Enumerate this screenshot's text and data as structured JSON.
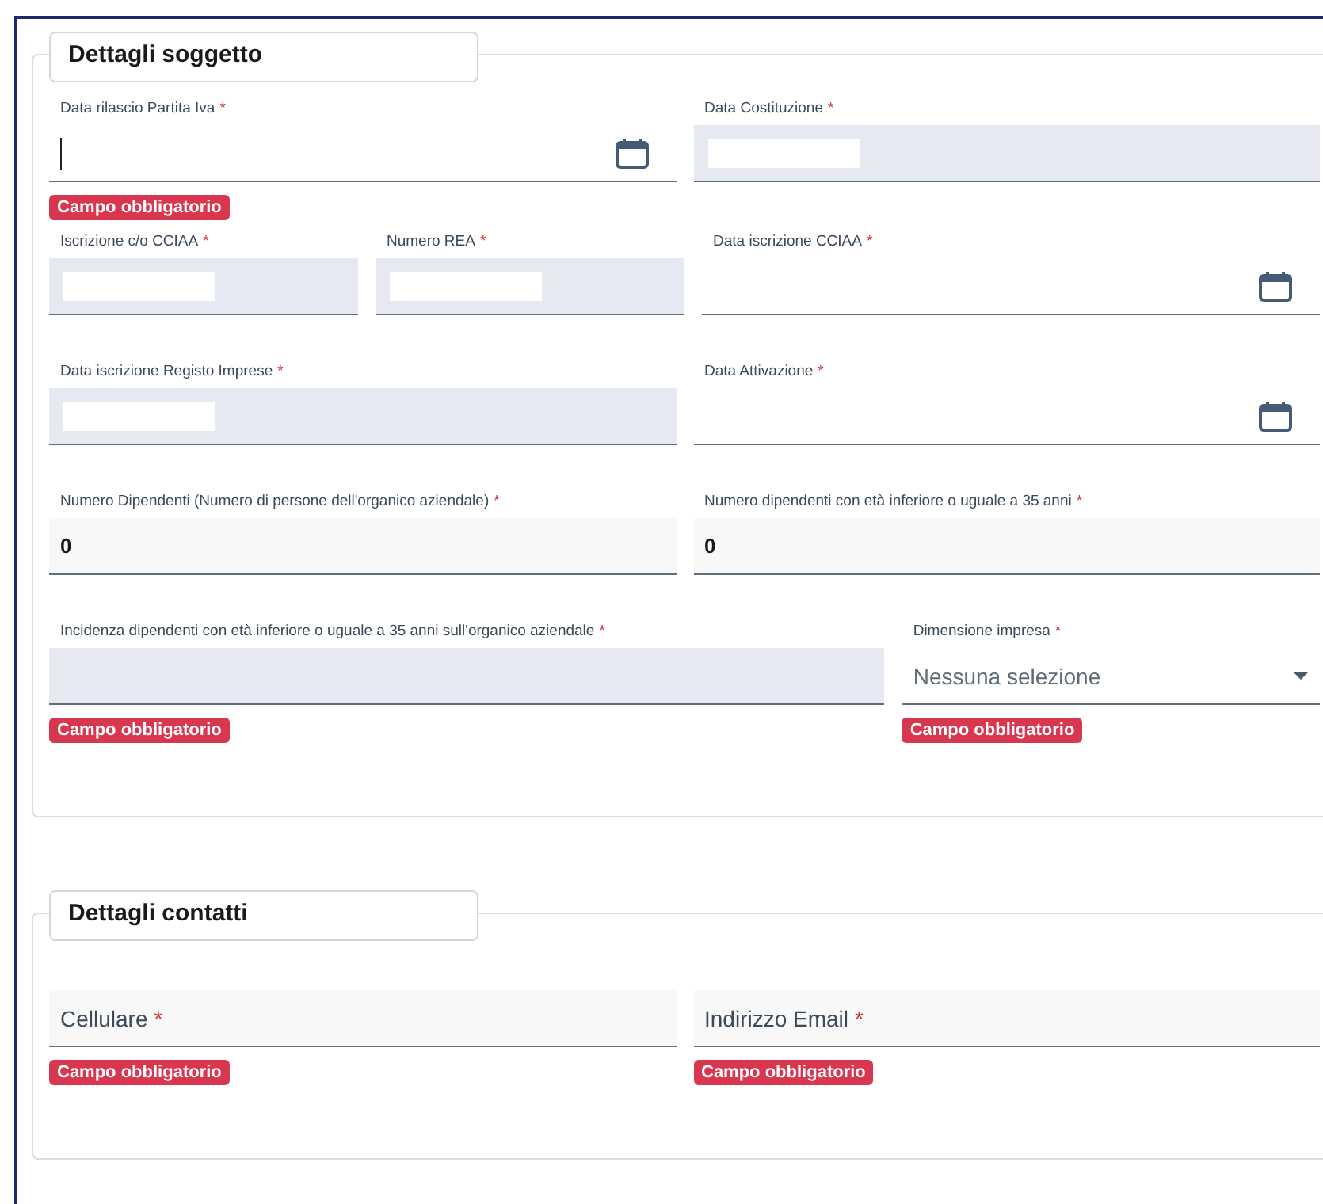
{
  "sections": [
    {
      "title": "Dettagli soggetto",
      "rows": [
        [
          {
            "kind": "date",
            "label": "Data rilascio Partita Iva",
            "mark": "*",
            "focused": true,
            "error": "Campo obbligatorio"
          },
          {
            "kind": "readonly",
            "label": "Data Costituzione",
            "mark": "*",
            "redacted": true
          }
        ],
        [
          {
            "kind": "readonly",
            "label": "Iscrizione c/o CCIAA",
            "mark": "*",
            "redacted": true
          },
          {
            "kind": "readonly",
            "label": "Numero REA",
            "mark": "*",
            "redacted": true
          },
          {
            "kind": "date",
            "label": "Data iscrizione CCIAA",
            "mark": "*"
          }
        ],
        [
          {
            "kind": "readonly",
            "label": "Data iscrizione Registo Imprese",
            "mark": "*",
            "redacted": true
          },
          {
            "kind": "date",
            "label": "Data Attivazione",
            "mark": "*"
          }
        ],
        [
          {
            "kind": "number",
            "label": "Numero Dipendenti (Numero di persone dell'organico aziendale)",
            "mark": "*",
            "value": "0"
          },
          {
            "kind": "number",
            "label": "Numero dipendenti con età inferiore o uguale a 35 anni",
            "mark": "*",
            "value": "0"
          }
        ],
        [
          {
            "kind": "readonly",
            "label": "Incidenza dipendenti con età inferiore o uguale a 35 anni sull'organico aziendale",
            "mark": "*",
            "error": "Campo obbligatorio"
          },
          {
            "kind": "select",
            "label": "Dimensione impresa",
            "mark": "*",
            "placeholder": "Nessuna selezione",
            "error": "Campo obbligatorio"
          }
        ]
      ]
    },
    {
      "title": "Dettagli contatti",
      "rows": [
        [
          {
            "kind": "text",
            "label": "Cellulare",
            "mark": "*",
            "error": "Campo obbligatorio"
          },
          {
            "kind": "text",
            "label": "Indirizzo Email",
            "mark": "*",
            "error": "Campo obbligatorio"
          }
        ]
      ]
    }
  ]
}
